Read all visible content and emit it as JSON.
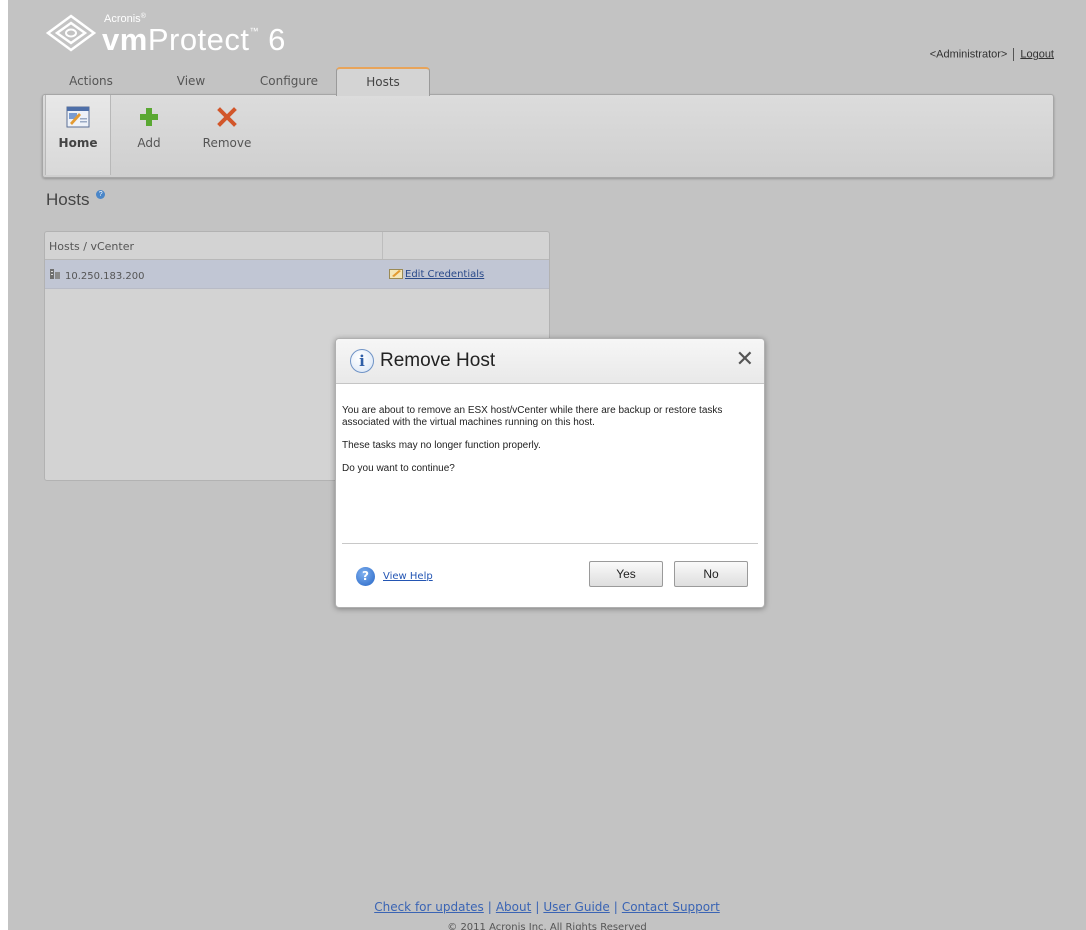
{
  "brand": {
    "company": "Acronis",
    "product_bold": "vm",
    "product_rest": "Protect",
    "trademark": "™",
    "version": "6"
  },
  "user": {
    "name": "<Administrator>",
    "logout": "Logout"
  },
  "tabs": [
    {
      "label": "Actions"
    },
    {
      "label": "View"
    },
    {
      "label": "Configure"
    },
    {
      "label": "Hosts",
      "active": true
    }
  ],
  "ribbon": {
    "home": "Home",
    "add": "Add",
    "remove": "Remove"
  },
  "section": {
    "title": "Hosts",
    "help": "?"
  },
  "hosts_table": {
    "column_header": "Hosts / vCenter",
    "rows": [
      {
        "host": "10.250.183.200",
        "action": "Edit Credentials"
      }
    ]
  },
  "dialog": {
    "title": "Remove Host",
    "info_glyph": "i",
    "close": "✕",
    "message1": "You are about to remove an ESX host/vCenter while there are backup or restore tasks associated with the virtual machines running on this host.",
    "message2": "These tasks may no longer function properly.",
    "message3": "Do you want to continue?",
    "help_glyph": "?",
    "view_help": "View Help",
    "yes": "Yes",
    "no": "No"
  },
  "footer": {
    "links": [
      "Check for updates",
      "About",
      "User Guide",
      "Contact Support"
    ],
    "separator": "|",
    "copyright": "© 2011 Acronis Inc. All Rights Reserved"
  },
  "colors": {
    "background": "#c3c3c3",
    "active_tab_accent": "#e8a45a",
    "selected_row": "#c1c6d4",
    "link": "#3a64b4",
    "add_icon": "#5aa832",
    "remove_icon": "#d2562a"
  }
}
